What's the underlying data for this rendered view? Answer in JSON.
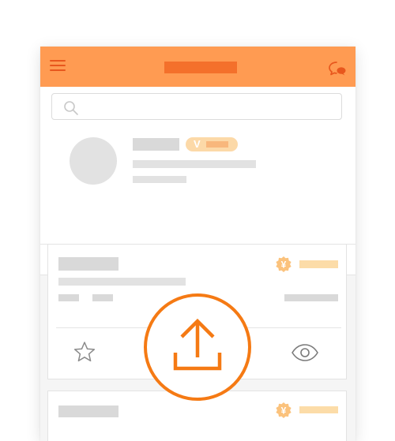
{
  "colors": {
    "brand": "#ff9b52",
    "accent_dark": "#f4702b",
    "upload_orange": "#f57a14",
    "placeholder_gray": "#d9d9d9",
    "badge_light": "#fcd9a8"
  },
  "header": {
    "menu_icon": "hamburger-menu-icon",
    "chat_icon": "chat-bubble-icon"
  },
  "search": {
    "icon": "search-icon",
    "placeholder": "",
    "value": ""
  },
  "profile": {
    "vip_label": "V"
  },
  "cards": [
    {
      "price_symbol": "¥",
      "actions": [
        "star-icon",
        "upload-icon",
        "eye-icon"
      ]
    },
    {
      "price_symbol": "¥"
    }
  ]
}
